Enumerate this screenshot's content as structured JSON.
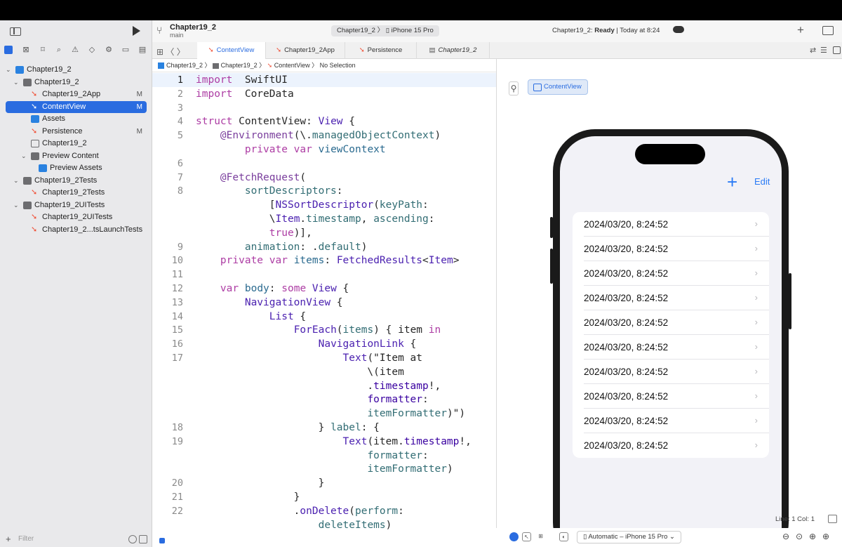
{
  "window": {
    "project_name": "Chapter19_2",
    "branch": "main",
    "scheme_target": "Chapter19_2",
    "scheme_device": "iPhone 15 Pro",
    "status_prefix": "Chapter19_2: ",
    "status_bold": "Ready",
    "status_suffix": " | Today at 8:24"
  },
  "tabs": [
    {
      "label": "ContentView",
      "active": true
    },
    {
      "label": "Chapter19_2App",
      "active": false
    },
    {
      "label": "Persistence",
      "active": false
    },
    {
      "label": "Chapter19_2",
      "active": false
    }
  ],
  "jumpbar": {
    "items": [
      "Chapter19_2",
      "Chapter19_2",
      "ContentView",
      "No Selection"
    ]
  },
  "navigator": {
    "items": [
      {
        "label": "Chapter19_2",
        "level": 0,
        "kind": "project",
        "expanded": true,
        "badge": ""
      },
      {
        "label": "Chapter19_2",
        "level": 1,
        "kind": "folder",
        "expanded": true,
        "badge": ""
      },
      {
        "label": "Chapter19_2App",
        "level": 2,
        "kind": "swift",
        "badge": "M"
      },
      {
        "label": "ContentView",
        "level": 2,
        "kind": "swift",
        "badge": "M",
        "selected": true
      },
      {
        "label": "Assets",
        "level": 2,
        "kind": "assets",
        "badge": ""
      },
      {
        "label": "Persistence",
        "level": 2,
        "kind": "swift",
        "badge": "M"
      },
      {
        "label": "Chapter19_2",
        "level": 2,
        "kind": "datamodel",
        "badge": ""
      },
      {
        "label": "Preview Content",
        "level": 2,
        "kind": "folder",
        "expanded": true,
        "badge": ""
      },
      {
        "label": "Preview Assets",
        "level": 3,
        "kind": "assets",
        "badge": ""
      },
      {
        "label": "Chapter19_2Tests",
        "level": 1,
        "kind": "folder",
        "expanded": true,
        "badge": ""
      },
      {
        "label": "Chapter19_2Tests",
        "level": 2,
        "kind": "swift",
        "badge": ""
      },
      {
        "label": "Chapter19_2UITests",
        "level": 1,
        "kind": "folder",
        "expanded": true,
        "badge": ""
      },
      {
        "label": "Chapter19_2UITests",
        "level": 2,
        "kind": "swift",
        "badge": ""
      },
      {
        "label": "Chapter19_2...tsLaunchTests",
        "level": 2,
        "kind": "swift",
        "badge": ""
      }
    ],
    "filter_placeholder": "Filter"
  },
  "editor": {
    "line_numbers": [
      "1",
      "2",
      "3",
      "4",
      "5",
      "",
      "6",
      "7",
      "8",
      "",
      "",
      "",
      "9",
      "10",
      "11",
      "12",
      "13",
      "14",
      "15",
      "16",
      "17",
      "",
      "",
      "",
      "",
      "18",
      "19",
      "",
      "",
      "20",
      "21",
      "22",
      ""
    ],
    "lines": [
      [
        [
          "kw",
          "import"
        ],
        [
          "",
          "  SwiftUI"
        ]
      ],
      [
        [
          "kw",
          "import"
        ],
        [
          "",
          "  CoreData"
        ]
      ],
      [
        [
          "",
          ""
        ]
      ],
      [
        [
          "kw",
          "struct"
        ],
        [
          "",
          " ContentView: "
        ],
        [
          "ty",
          "View"
        ],
        [
          "",
          " {"
        ]
      ],
      [
        [
          "",
          " "
        ],
        [
          "at",
          "   @Environment"
        ],
        [
          "",
          "(\\."
        ],
        [
          "mth",
          "managedObjectContext"
        ],
        [
          "",
          ")"
        ]
      ],
      [
        [
          "",
          "        "
        ],
        [
          "kw",
          "private var"
        ],
        [
          "",
          " "
        ],
        [
          "fn",
          "viewContext"
        ]
      ],
      [
        [
          "",
          ""
        ]
      ],
      [
        [
          "",
          "    "
        ],
        [
          "at",
          "@FetchRequest"
        ],
        [
          "",
          "("
        ]
      ],
      [
        [
          "",
          "        "
        ],
        [
          "mth",
          "sortDescriptors"
        ],
        [
          "",
          ":"
        ]
      ],
      [
        [
          "",
          "            ["
        ],
        [
          "ty",
          "NSSortDescriptor"
        ],
        [
          "",
          "("
        ],
        [
          "mth",
          "keyPath"
        ],
        [
          "",
          ":"
        ]
      ],
      [
        [
          "",
          "            \\"
        ],
        [
          "ty",
          "Item"
        ],
        [
          "",
          "."
        ],
        [
          "mth",
          "timestamp"
        ],
        [
          "",
          ", "
        ],
        [
          "mth",
          "ascending"
        ],
        [
          "",
          ":"
        ]
      ],
      [
        [
          "",
          "            "
        ],
        [
          "kw",
          "true"
        ],
        [
          "",
          ")],"
        ]
      ],
      [
        [
          "",
          "        "
        ],
        [
          "mth",
          "animation"
        ],
        [
          "",
          ": ."
        ],
        [
          "mth",
          "default"
        ],
        [
          "",
          ")"
        ]
      ],
      [
        [
          "",
          "    "
        ],
        [
          "kw",
          "private var"
        ],
        [
          "",
          " "
        ],
        [
          "fn",
          "items"
        ],
        [
          "",
          ": "
        ],
        [
          "ty",
          "FetchedResults"
        ],
        [
          "",
          "<"
        ],
        [
          "ty",
          "Item"
        ],
        [
          "",
          ">"
        ]
      ],
      [
        [
          "",
          ""
        ]
      ],
      [
        [
          "",
          "    "
        ],
        [
          "kw",
          "var"
        ],
        [
          "",
          " "
        ],
        [
          "fn",
          "body"
        ],
        [
          "",
          ": "
        ],
        [
          "kw",
          "some"
        ],
        [
          "",
          " "
        ],
        [
          "ty",
          "View"
        ],
        [
          "",
          " {"
        ]
      ],
      [
        [
          "",
          "        "
        ],
        [
          "ty",
          "NavigationView"
        ],
        [
          "",
          " {"
        ]
      ],
      [
        [
          "",
          "            "
        ],
        [
          "ty",
          "List"
        ],
        [
          "",
          " {"
        ]
      ],
      [
        [
          "",
          "                "
        ],
        [
          "ty",
          "ForEach"
        ],
        [
          "",
          "("
        ],
        [
          "mth",
          "items"
        ],
        [
          "",
          ") { item "
        ],
        [
          "kw",
          "in"
        ]
      ],
      [
        [
          "",
          "                    "
        ],
        [
          "ty",
          "NavigationLink"
        ],
        [
          "",
          " {"
        ]
      ],
      [
        [
          "",
          "                        "
        ],
        [
          "ty",
          "Text"
        ],
        [
          "",
          "(\"Item at"
        ]
      ],
      [
        [
          "",
          "                            \\(item"
        ]
      ],
      [
        [
          "",
          "                            ."
        ],
        [
          "pr",
          "timestamp"
        ],
        [
          "",
          "!,"
        ]
      ],
      [
        [
          "",
          "                            "
        ],
        [
          "pr",
          "formatter"
        ],
        [
          "",
          ":"
        ]
      ],
      [
        [
          "",
          "                            "
        ],
        [
          "mth",
          "itemFormatter"
        ],
        [
          "",
          ")\")"
        ]
      ],
      [
        [
          "",
          "                    } "
        ],
        [
          "mth",
          "label"
        ],
        [
          "",
          ": {"
        ]
      ],
      [
        [
          "",
          "                        "
        ],
        [
          "ty",
          "Text"
        ],
        [
          "",
          "(item."
        ],
        [
          "pr",
          "timestamp"
        ],
        [
          "",
          "!,"
        ]
      ],
      [
        [
          "",
          "                            "
        ],
        [
          "mth",
          "formatter"
        ],
        [
          "",
          ":"
        ]
      ],
      [
        [
          "",
          "                            "
        ],
        [
          "mth",
          "itemFormatter"
        ],
        [
          "",
          ")"
        ]
      ],
      [
        [
          "",
          "                    }"
        ]
      ],
      [
        [
          "",
          "                }"
        ]
      ],
      [
        [
          "",
          "                ."
        ],
        [
          "ty",
          "onDelete"
        ],
        [
          "",
          "("
        ],
        [
          "mth",
          "perform"
        ],
        [
          "",
          ":"
        ]
      ],
      [
        [
          "",
          "                    "
        ],
        [
          "mth",
          "deleteItems"
        ],
        [
          "",
          ")"
        ]
      ]
    ]
  },
  "preview": {
    "tab_label": "ContentView",
    "nav_plus": "+",
    "nav_edit": "Edit",
    "rows": [
      "2024/03/20, 8:24:52",
      "2024/03/20, 8:24:52",
      "2024/03/20, 8:24:52",
      "2024/03/20, 8:24:52",
      "2024/03/20, 8:24:52",
      "2024/03/20, 8:24:52",
      "2024/03/20, 8:24:52",
      "2024/03/20, 8:24:52",
      "2024/03/20, 8:24:52",
      "2024/03/20, 8:24:52"
    ],
    "device_selector": "Automatic – iPhone 15 Pro"
  },
  "statusbar": {
    "line_col": "Line: 1  Col: 1"
  },
  "colors": {
    "accent": "#2a6ce0",
    "swift": "#f05138",
    "ios_blue": "#2a7bf6"
  }
}
